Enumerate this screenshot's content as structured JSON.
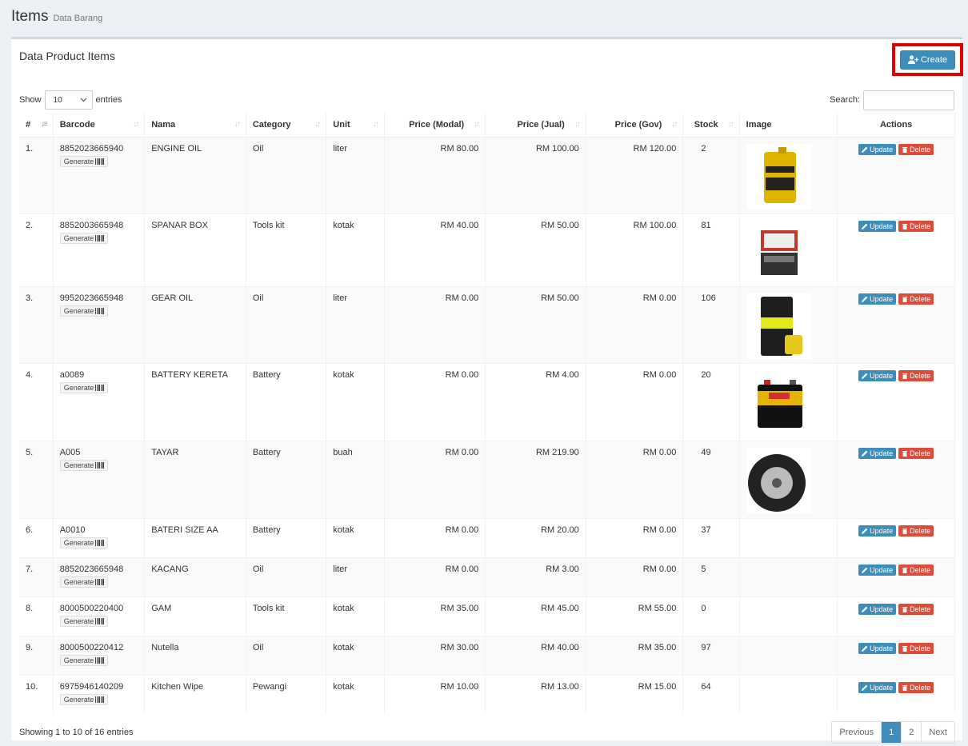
{
  "header": {
    "title": "Items",
    "subtitle": "Data Barang"
  },
  "box": {
    "title": "Data Product Items",
    "create_label": "Create"
  },
  "controls": {
    "show_label": "Show",
    "entries_value": "10",
    "entries_label": "entries",
    "search_label": "Search:"
  },
  "columns": [
    "#",
    "Barcode",
    "Nama",
    "Category",
    "Unit",
    "Price (Modal)",
    "Price (Jual)",
    "Price (Gov)",
    "Stock",
    "Image",
    "Actions"
  ],
  "row_buttons": {
    "generate": "Generate",
    "update": "Update",
    "delete": "Delete"
  },
  "rows": [
    {
      "no": "1.",
      "barcode": "8852023665940",
      "nama": "ENGINE OIL",
      "category": "Oil",
      "unit": "liter",
      "modal": "RM 80.00",
      "jual": "RM 100.00",
      "gov": "RM 120.00",
      "stock": "2",
      "image": "engine-oil-can"
    },
    {
      "no": "2.",
      "barcode": "8852003665948",
      "nama": "SPANAR BOX",
      "category": "Tools kit",
      "unit": "kotak",
      "modal": "RM 40.00",
      "jual": "RM 50.00",
      "gov": "RM 100.00",
      "stock": "81",
      "image": "tool-box"
    },
    {
      "no": "3.",
      "barcode": "9952023665948",
      "nama": "GEAR OIL",
      "category": "Oil",
      "unit": "liter",
      "modal": "RM 0.00",
      "jual": "RM 50.00",
      "gov": "RM 0.00",
      "stock": "106",
      "image": "gear-oil-drum"
    },
    {
      "no": "4.",
      "barcode": "a0089",
      "nama": "BATTERY KERETA",
      "category": "Battery",
      "unit": "kotak",
      "modal": "RM 0.00",
      "jual": "RM 4.00",
      "gov": "RM 0.00",
      "stock": "20",
      "image": "car-battery"
    },
    {
      "no": "5.",
      "barcode": "A005",
      "nama": "TAYAR",
      "category": "Battery",
      "unit": "buah",
      "modal": "RM 0.00",
      "jual": "RM 219.90",
      "gov": "RM 0.00",
      "stock": "49",
      "image": "tyre"
    },
    {
      "no": "6.",
      "barcode": "A0010",
      "nama": "BATERI SIZE AA",
      "category": "Battery",
      "unit": "kotak",
      "modal": "RM 0.00",
      "jual": "RM 20.00",
      "gov": "RM 0.00",
      "stock": "37",
      "image": ""
    },
    {
      "no": "7.",
      "barcode": "8852023665948",
      "nama": "KACANG",
      "category": "Oil",
      "unit": "liter",
      "modal": "RM 0.00",
      "jual": "RM 3.00",
      "gov": "RM 0.00",
      "stock": "5",
      "image": ""
    },
    {
      "no": "8.",
      "barcode": "8000500220400",
      "nama": "GAM",
      "category": "Tools kit",
      "unit": "kotak",
      "modal": "RM 35.00",
      "jual": "RM 45.00",
      "gov": "RM 55.00",
      "stock": "0",
      "image": ""
    },
    {
      "no": "9.",
      "barcode": "8000500220412",
      "nama": "Nutella",
      "category": "Oil",
      "unit": "kotak",
      "modal": "RM 30.00",
      "jual": "RM 40.00",
      "gov": "RM 35.00",
      "stock": "97",
      "image": ""
    },
    {
      "no": "10.",
      "barcode": "6975946140209",
      "nama": "Kitchen Wipe",
      "category": "Pewangi",
      "unit": "kotak",
      "modal": "RM 10.00",
      "jual": "RM 13.00",
      "gov": "RM 15.00",
      "stock": "64",
      "image": ""
    }
  ],
  "footer": {
    "info": "Showing 1 to 10 of 16 entries",
    "pages": [
      "Previous",
      "1",
      "2",
      "Next"
    ],
    "active_page": "1"
  },
  "colors": {
    "primary": "#3c8dbc",
    "danger": "#dd4b39",
    "highlight": "#e00000"
  }
}
